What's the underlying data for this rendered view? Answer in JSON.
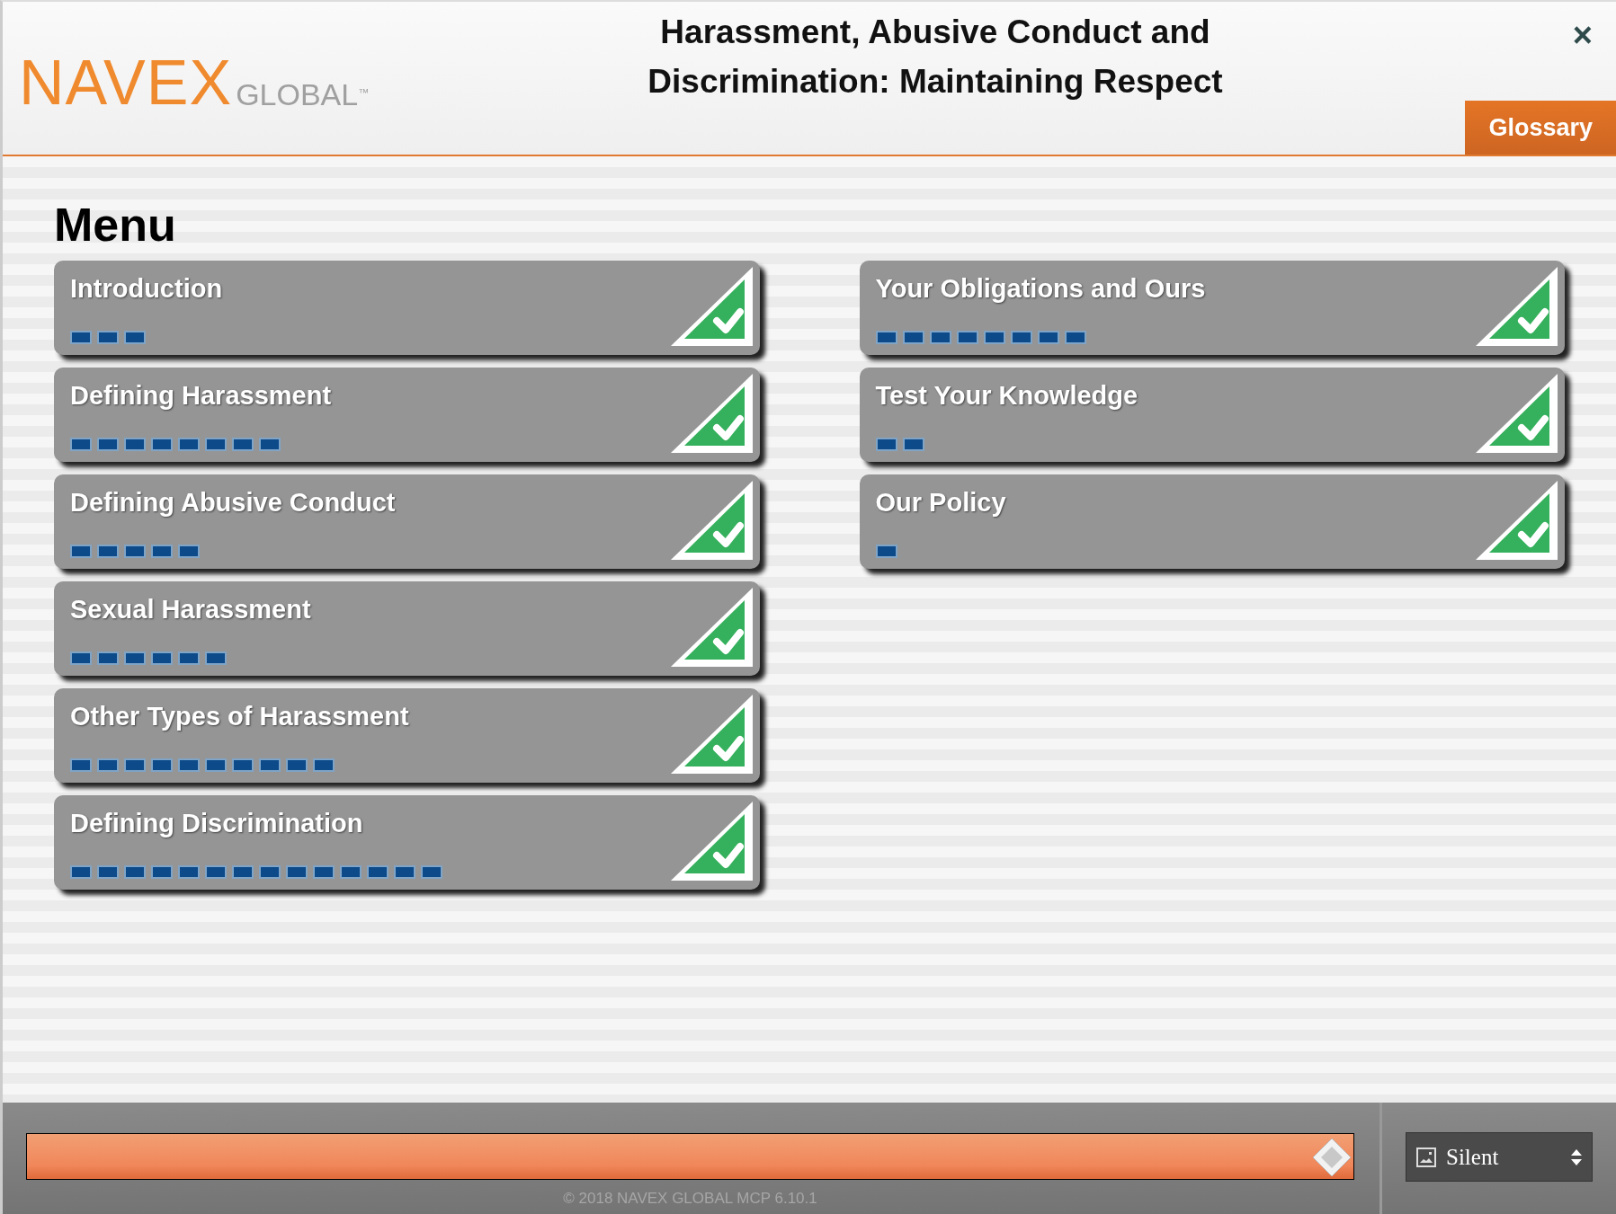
{
  "header": {
    "logo": {
      "wordmark": "NAVEX",
      "suffix": "GLOBAL",
      "trademark": "™"
    },
    "title": "Harassment, Abusive Conduct and Discrimination: Maintaining Respect",
    "close": "×",
    "glossary_button": "Glossary"
  },
  "menu": {
    "heading": "Menu",
    "columns": [
      [
        {
          "title": "Introduction",
          "completed": true,
          "pages": [
            {
              "visited": true
            },
            {
              "visited": true
            },
            {
              "visited": true
            }
          ]
        },
        {
          "title": "Defining Harassment",
          "completed": true,
          "pages": [
            {
              "visited": true
            },
            {
              "visited": true
            },
            {
              "visited": true
            },
            {
              "visited": true
            },
            {
              "visited": true
            },
            {
              "visited": true
            },
            {
              "visited": true
            },
            {
              "visited": true
            }
          ]
        },
        {
          "title": "Defining Abusive Conduct",
          "completed": true,
          "pages": [
            {
              "visited": true
            },
            {
              "visited": true
            },
            {
              "visited": true
            },
            {
              "visited": true
            },
            {
              "visited": true
            }
          ]
        },
        {
          "title": "Sexual Harassment",
          "completed": true,
          "pages": [
            {
              "visited": true
            },
            {
              "visited": true
            },
            {
              "visited": true
            },
            {
              "visited": true
            },
            {
              "visited": true
            },
            {
              "visited": true
            }
          ]
        },
        {
          "title": "Other Types of Harassment",
          "completed": true,
          "pages": [
            {
              "visited": true
            },
            {
              "visited": true
            },
            {
              "visited": true
            },
            {
              "visited": true
            },
            {
              "visited": true
            },
            {
              "visited": true
            },
            {
              "visited": true
            },
            {
              "visited": true
            },
            {
              "visited": true
            },
            {
              "visited": true
            }
          ]
        },
        {
          "title": "Defining Discrimination",
          "completed": true,
          "pages": [
            {
              "visited": true
            },
            {
              "visited": true
            },
            {
              "visited": true
            },
            {
              "visited": true
            },
            {
              "visited": true
            },
            {
              "visited": true
            },
            {
              "visited": true
            },
            {
              "visited": true
            },
            {
              "visited": true
            },
            {
              "visited": true
            },
            {
              "visited": true
            },
            {
              "visited": true
            },
            {
              "visited": true
            },
            {
              "visited": true
            }
          ]
        }
      ],
      [
        {
          "title": "Your Obligations and Ours",
          "completed": true,
          "pages": [
            {
              "visited": true
            },
            {
              "visited": true
            },
            {
              "visited": true
            },
            {
              "visited": true
            },
            {
              "visited": true
            },
            {
              "visited": true
            },
            {
              "visited": true
            },
            {
              "visited": true
            }
          ]
        },
        {
          "title": "Test Your Knowledge",
          "completed": true,
          "pages": [
            {
              "visited": true
            },
            {
              "visited": true
            }
          ]
        },
        {
          "title": "Our Policy",
          "completed": true,
          "pages": [
            {
              "visited": true
            }
          ]
        }
      ]
    ]
  },
  "footer": {
    "progress": {
      "level": 1
    },
    "audio_select": {
      "value": "Silent"
    },
    "copyright": "© 2018 NAVEX GLOBAL MCP 6.10.1"
  }
}
